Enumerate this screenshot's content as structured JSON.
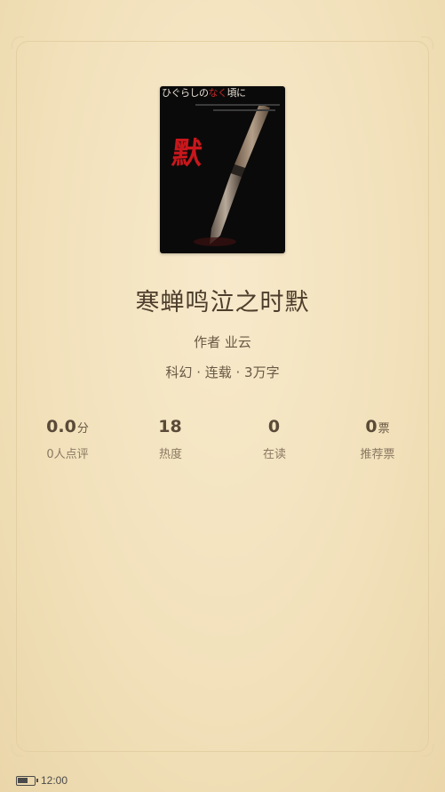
{
  "book": {
    "title": "寒蝉鸣泣之时默",
    "author_line": "作者 业云",
    "meta_line": "科幻 · 连载 · 3万字",
    "cover": {
      "top_text_prefix": "ひぐらしの",
      "top_text_red": "なく",
      "top_text_suffix": "頃に",
      "kanji": "默"
    }
  },
  "stats": [
    {
      "value": "0.0",
      "unit": "分",
      "label": "0人点评"
    },
    {
      "value": "18",
      "unit": "",
      "label": "热度"
    },
    {
      "value": "0",
      "unit": "",
      "label": "在读"
    },
    {
      "value": "0",
      "unit": "票",
      "label": "推荐票"
    }
  ],
  "status_bar": {
    "time": "12:00",
    "battery_level": 0.65
  },
  "colors": {
    "background": "#f4e4c0",
    "title_text": "#4d3d2c",
    "cover_kanji": "#c8171c"
  }
}
